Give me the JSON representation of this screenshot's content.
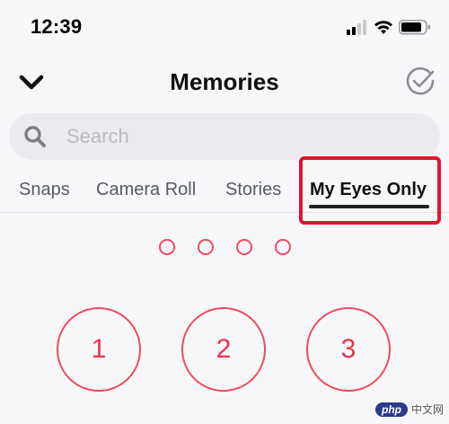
{
  "status_bar": {
    "time": "12:39",
    "signal_icon": "cellular-signal-icon",
    "wifi_icon": "wifi-icon",
    "battery_icon": "battery-icon"
  },
  "header": {
    "title": "Memories",
    "back_icon": "chevron-down-icon",
    "select_icon": "check-circle-icon"
  },
  "search": {
    "placeholder": "Search",
    "value": "",
    "icon": "search-icon"
  },
  "tabs": [
    {
      "label": "Snaps",
      "active": false
    },
    {
      "label": "Camera Roll",
      "active": false
    },
    {
      "label": "Stories",
      "active": false
    },
    {
      "label": "My Eyes Only",
      "active": true
    }
  ],
  "passcode": {
    "length": 4,
    "entered": 0
  },
  "keypad": {
    "keys": [
      "1",
      "2",
      "3"
    ]
  },
  "watermark": {
    "logo": "php",
    "text": "中文网"
  },
  "colors": {
    "accent": "#f04a5f",
    "key_text": "#e8344a",
    "highlight": "#e1152b",
    "background": "#f7f7f9",
    "search_bg": "#ebebef"
  }
}
